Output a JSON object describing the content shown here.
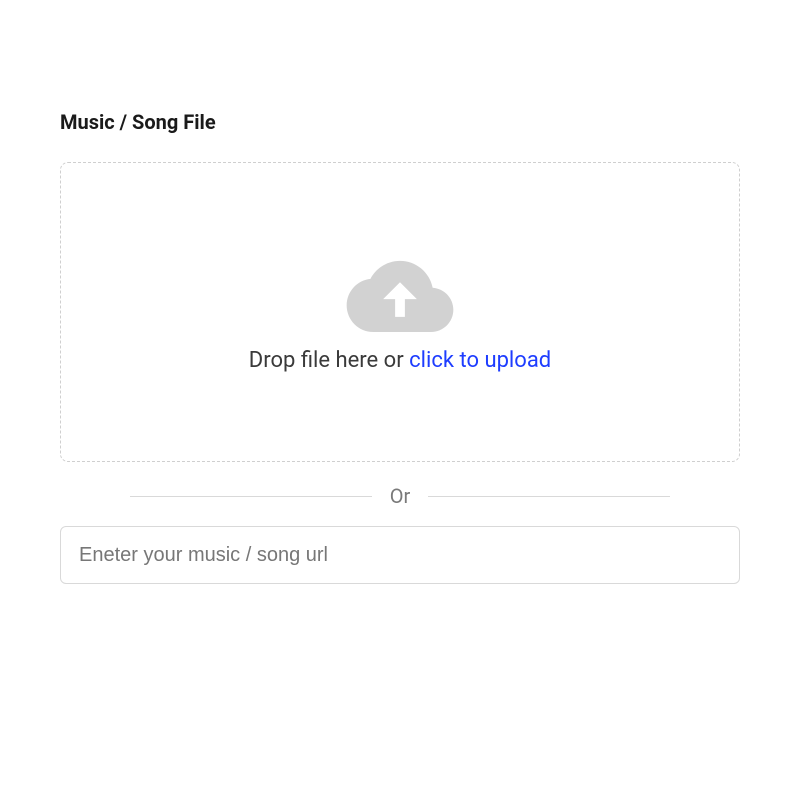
{
  "section": {
    "title": "Music / Song File"
  },
  "upload": {
    "drop_text_prefix": "Drop file here or ",
    "click_text": "click to upload"
  },
  "divider": {
    "label": "Or"
  },
  "url_input": {
    "placeholder": "Eneter your music / song url",
    "value": ""
  }
}
